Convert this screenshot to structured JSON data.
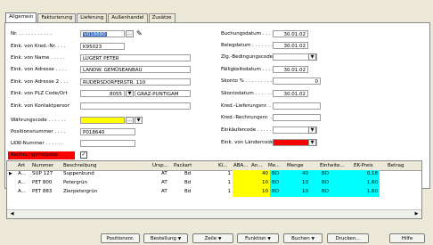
{
  "tabs": [
    "Allgemein",
    "Fakturierung",
    "Lieferung",
    "Außenhandel",
    "Zusätze"
  ],
  "left_fields": [
    {
      "label": "Nr. . . . . . . . . . . .",
      "value": "V018680"
    },
    {
      "label": "Eink. von Kred.-Nr. . . .",
      "value": "K95023"
    },
    {
      "label": "Eink. von Name . . . . .",
      "value": "LUGERT PETER"
    },
    {
      "label": "Eink. von Adresse . . . .",
      "value": "LANDW. GEMÜSEANBAU"
    },
    {
      "label": "Eink. von Adresse 2 . . .",
      "value": "RUDERSDORFERSTR. 110"
    },
    {
      "label": "Eink. von PLZ Code/Ort .",
      "value": "8055",
      "value2": "GRAZ-PUNTIGAM"
    },
    {
      "label": "Eink. von Kontaktperson.",
      "value": ""
    },
    {
      "label": "Währungscode . . . . . .",
      "value": ""
    },
    {
      "label": "Positionsnummer . . . .",
      "value": "P018640"
    },
    {
      "label": "LKW-Nummer . . . . . .",
      "value": ""
    },
    {
      "label": "Rechnungsfreigabe . . .",
      "value": "✓"
    }
  ],
  "right_fields": [
    {
      "label": "Buchungsdatum . . . . . .",
      "value": "30.01.02"
    },
    {
      "label": "Belegdatum . . . . . . . .",
      "value": "30.01.02"
    },
    {
      "label": "Zlg.-Bedingungscode . .",
      "value": ""
    },
    {
      "label": "Fälligkeitsdatum . . . . .",
      "value": "30.01.02"
    },
    {
      "label": "Skonto % . . . . . . . . .",
      "value": "0"
    },
    {
      "label": "Skontodatum . . . . . . .",
      "value": "30.01.02"
    },
    {
      "label": "Kred.-Lieferungsnr. . . .",
      "value": ""
    },
    {
      "label": "Kred.-Rechnungsnr. . . .",
      "value": ""
    },
    {
      "label": "Einkäufercode . . . . . .",
      "value": ""
    },
    {
      "label": "Eink. von Ländercode . .",
      "value": ""
    }
  ],
  "grid": {
    "headers": [
      "Art",
      "Nummer",
      "Beschreibung",
      "Ursp...",
      "Packart",
      "Kl...",
      "ABA...",
      "An...",
      "Me...",
      "Menge",
      "Einheite...",
      "EK-Preis",
      "Betrag"
    ],
    "rows": [
      [
        "A...",
        "SUP 127",
        "Suppenbund",
        "AT",
        "Bd",
        "1",
        "",
        "40",
        "BD",
        "40",
        "BD",
        "0,18",
        ""
      ],
      [
        "A...",
        "PET 800",
        "Petergrün",
        "AT",
        "Bd",
        "1",
        "",
        "10",
        "BD",
        "10",
        "BD",
        "1,60",
        ""
      ],
      [
        "A...",
        "PET 883",
        "Zierpetergrün",
        "AT",
        "Bd",
        "1",
        "",
        "10",
        "BD",
        "10",
        "BD",
        "1,60",
        ""
      ]
    ]
  },
  "buttons": [
    {
      "label": "Positionsnr."
    },
    {
      "label": "Bestellung",
      "dropdown": "▼"
    },
    {
      "label": "Zeile",
      "dropdown": "▼"
    },
    {
      "label": "Funktion",
      "dropdown": "▼"
    },
    {
      "label": "Buchen",
      "dropdown": "▼"
    },
    {
      "label": "Drucken..."
    },
    {
      "label": "Hilfe"
    }
  ],
  "icons": {
    "lookup": "…",
    "dropdown": "▼",
    "pencil": "✎",
    "row_pointer": "▶",
    "scroll_left": "◀",
    "scroll_right": "▶"
  },
  "colors": {
    "yellow": "#ffff00",
    "cyan": "#00ffff",
    "red": "#ff0000",
    "highlight": "#316ac5"
  }
}
